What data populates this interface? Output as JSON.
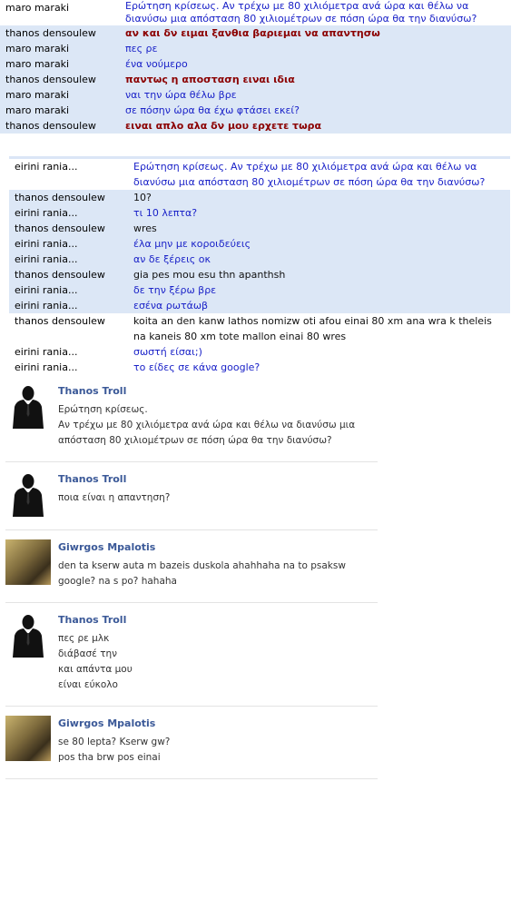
{
  "chat1": [
    {
      "name": "maro maraki",
      "msg": "Ερώτηση κρίσεως. Αν τρέχω με 80 χιλιόμετρα ανά ώρα και θέλω να διανύσω μια απόσταση 80 χιλιομέτρων σε πόση ώρα θα την διανύσω?",
      "style": "blue",
      "hl": false
    },
    {
      "name": "thanos densoulew",
      "msg": "αν και δν ειμαι ξανθια βαριεμαι να απαντησω",
      "style": "red",
      "hl": true
    },
    {
      "name": "maro maraki",
      "msg": "πες ρε",
      "style": "blue",
      "hl": true
    },
    {
      "name": "maro maraki",
      "msg": "ένα νούμερο",
      "style": "blue",
      "hl": true
    },
    {
      "name": "thanos densoulew",
      "msg": "παντως η αποσταση ειναι ιδια",
      "style": "red",
      "hl": true
    },
    {
      "name": "maro maraki",
      "msg": "ναι την ώρα θέλω βρε",
      "style": "blue",
      "hl": true
    },
    {
      "name": "maro maraki",
      "msg": "σε πόσην ώρα θα έχω φτάσει εκεί?",
      "style": "blue",
      "hl": true
    },
    {
      "name": "thanos densoulew",
      "msg": "ειναι απλο αλα δν μου ερχετε τωρα",
      "style": "red",
      "hl": true
    }
  ],
  "chat2": [
    {
      "name": "eirini rania...",
      "msg": "Ερώτηση κρίσεως. Αν τρέχω με 80 χιλιόμετρα ανά ώρα και θέλω να διανύσω μια απόσταση 80 χιλιομέτρων σε πόση ώρα θα την διανύσω?",
      "style": "blue",
      "hl": false
    },
    {
      "name": "thanos densoulew",
      "msg": "10?",
      "style": "black",
      "hl": true
    },
    {
      "name": "eirini rania...",
      "msg": "τι 10 λεπτα?",
      "style": "blue",
      "hl": true
    },
    {
      "name": "thanos densoulew",
      "msg": "wres",
      "style": "black",
      "hl": true
    },
    {
      "name": "eirini rania...",
      "msg": "έλα μην με κοροιδεύεις",
      "style": "blue",
      "hl": true
    },
    {
      "name": "eirini rania...",
      "msg": "αν δε ξέρεις οκ",
      "style": "blue",
      "hl": true
    },
    {
      "name": "thanos densoulew",
      "msg": "gia pes mou esu thn apanthsh",
      "style": "black",
      "hl": true
    },
    {
      "name": "eirini rania...",
      "msg": "δε την ξέρω βρε",
      "style": "blue",
      "hl": true
    },
    {
      "name": "eirini rania...",
      "msg": "εσένα ρωτάωβ",
      "style": "blue",
      "hl": true
    },
    {
      "name": "thanos densoulew",
      "msg": "koita an den kanw lathos nomizw oti afou einai 80 xm ana wra k theleis na kaneis 80 xm tote mallon einai 80 wres",
      "style": "black",
      "hl": false
    },
    {
      "name": "eirini rania...",
      "msg": "σωστή είσαι;)",
      "style": "blue",
      "hl": false
    },
    {
      "name": "eirini rania...",
      "msg": "το είδες σε κάνα google?",
      "style": "blue",
      "hl": false
    }
  ],
  "feed": [
    {
      "author": "Thanos Troll",
      "avatar": "suit",
      "lines": [
        "Ερώτηση κρίσεως.",
        "Αν τρέχω με 80 χιλιόμετρα ανά ώρα και θέλω να διανύσω μια απόσταση 80 χιλιομέτρων σε πόση ώρα θα την διανύσω?"
      ]
    },
    {
      "author": "Thanos Troll",
      "avatar": "suit",
      "lines": [
        "ποια είναι η απαντηση?"
      ]
    },
    {
      "author": "Giwrgos Mpalotis",
      "avatar": "photo",
      "lines": [
        "den ta kserw auta m bazeis duskola ahahhaha na to psaksw google? na s po? hahaha"
      ]
    },
    {
      "author": "Thanos Troll",
      "avatar": "suit",
      "lines": [
        "πες ρε μλκ",
        "διάβασέ την",
        "και απάντα μου",
        "είναι εύκολο"
      ]
    },
    {
      "author": "Giwrgos Mpalotis",
      "avatar": "photo",
      "lines": [
        "se 80 lepta? Kserw gw?",
        "pos tha brw pos einai"
      ]
    }
  ]
}
